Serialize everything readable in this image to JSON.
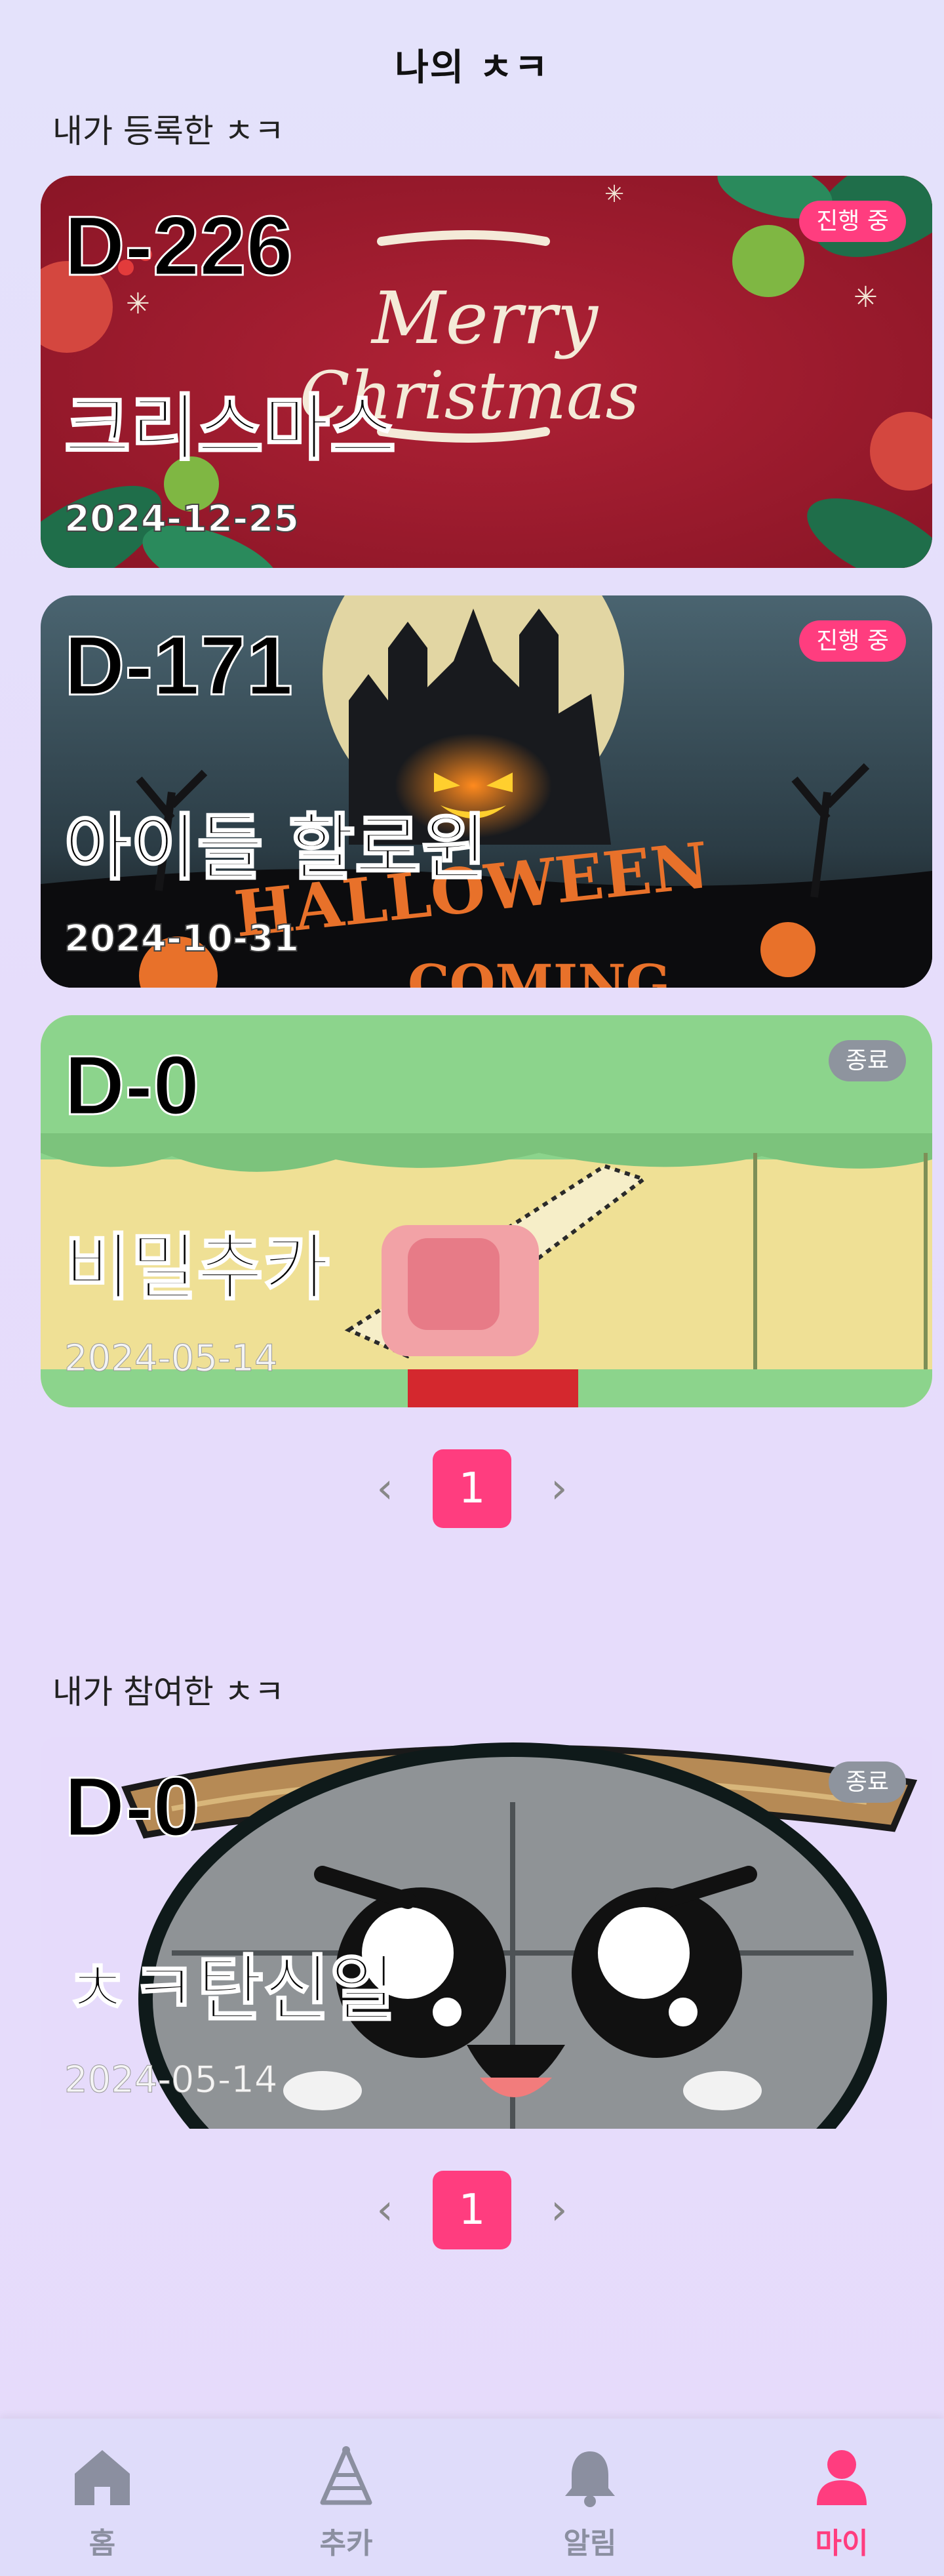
{
  "page": {
    "title": "나의 ㅊㅋ"
  },
  "colors": {
    "accent": "#ff3d7f",
    "ended_badge": "#8e949e",
    "inactive_tab": "#8b8fa0"
  },
  "registered": {
    "section_title": "내가 등록한 ㅊㅋ",
    "cards": [
      {
        "dday": "D-226",
        "name": "크리스마스",
        "date": "2024-12-25",
        "status": "진행 중",
        "image": "merry-christmas-art"
      },
      {
        "dday": "D-171",
        "name": "아이들 할로윈",
        "date": "2024-10-31",
        "status": "진행 중",
        "image": "halloween-art"
      },
      {
        "dday": "D-0",
        "name": "비밀추카",
        "date": "2024-05-14",
        "status": "종료",
        "image": "pixel-character-art"
      }
    ],
    "pagination": {
      "prev": "‹",
      "current": "1",
      "next": "›"
    }
  },
  "participated": {
    "section_title": "내가 참여한 ㅊㅋ",
    "cards": [
      {
        "dday": "D-0",
        "name": "ㅊㅋ탄신일",
        "date": "2024-05-14",
        "status": "종료",
        "image": "cute-character-art"
      }
    ],
    "pagination": {
      "prev": "‹",
      "current": "1",
      "next": "›"
    }
  },
  "tabbar": {
    "items": [
      {
        "label": "홈",
        "icon": "home-icon"
      },
      {
        "label": "추카",
        "icon": "party-hat-icon"
      },
      {
        "label": "알림",
        "icon": "bell-icon"
      },
      {
        "label": "마이",
        "icon": "user-icon",
        "active": true
      }
    ]
  }
}
